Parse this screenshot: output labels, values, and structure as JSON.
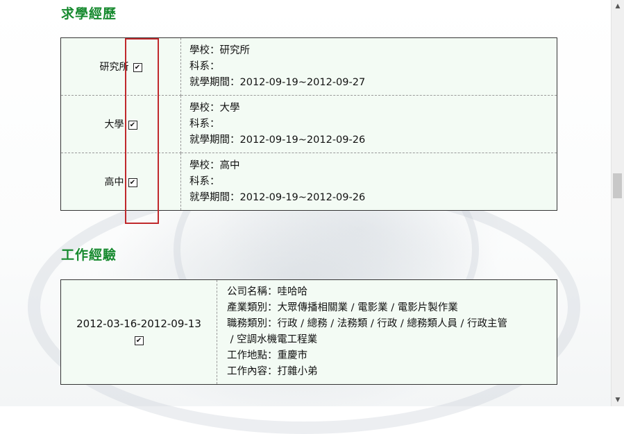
{
  "education": {
    "title": "求學經歷",
    "rows": [
      {
        "level": "研究所",
        "school": "學校：研究所",
        "dept": "科系：",
        "period": "就學期間：2012-09-19~2012-09-27"
      },
      {
        "level": "大學",
        "school": "學校：大學",
        "dept": "科系：",
        "period": "就學期間：2012-09-19~2012-09-26"
      },
      {
        "level": "高中",
        "school": "學校：高中",
        "dept": "科系：",
        "period": "就學期間：2012-09-19~2012-09-26"
      }
    ]
  },
  "work": {
    "title": "工作經驗",
    "period": "2012-03-16-2012-09-13",
    "company": "公司名稱：哇哈哈",
    "industry": "產業類別：大眾傳播相關業 / 電影業 / 電影片製作業",
    "job_line1": "職務類別：行政 / 總務 / 法務類 / 行政 / 總務類人員  / 行政主管",
    "job_line2": " / 空調水機電工程業",
    "location": "工作地點：重慶市",
    "content": "工作內容：打雜小弟"
  },
  "checkbox_mark": "✔",
  "scrollbar": {
    "up": "▲",
    "down": "▼"
  }
}
